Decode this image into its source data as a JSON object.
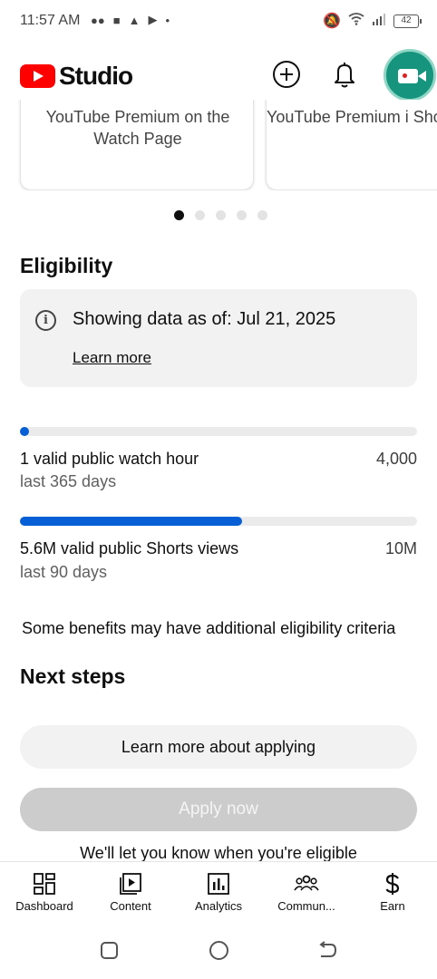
{
  "status_bar": {
    "time": "11:57 AM",
    "battery": "42"
  },
  "header": {
    "brand": "Studio",
    "icons": [
      "youtube-play-logo",
      "create-plus-icon",
      "notifications-bell-icon",
      "go-live-camera-icon"
    ]
  },
  "promo_cards": [
    {
      "text": "YouTube Premium on the Watch Page"
    },
    {
      "text": "YouTube Premium i Shorts Feed"
    }
  ],
  "carousel": {
    "total_dots": 5,
    "active_index": 0
  },
  "eligibility": {
    "title": "Eligibility",
    "info_text": "Showing data as of: Jul 21, 2025",
    "learn_more": "Learn more",
    "metrics": [
      {
        "label": "1 valid public watch hour",
        "period": "last 365 days",
        "goal": "4,000",
        "progress": 0.00025
      },
      {
        "label": "5.6M valid public Shorts views",
        "period": "last 90 days",
        "goal": "10M",
        "progress": 0.56
      }
    ],
    "note": "Some benefits may have additional eligibility criteria"
  },
  "next_steps": {
    "title": "Next steps",
    "learn_button": "Learn more about applying",
    "apply_button": "Apply now",
    "eligible_note": "We'll let you know when you're eligible"
  },
  "bottom_nav": [
    {
      "label": "Dashboard",
      "icon": "dashboard-icon"
    },
    {
      "label": "Content",
      "icon": "content-icon"
    },
    {
      "label": "Analytics",
      "icon": "analytics-icon"
    },
    {
      "label": "Commun...",
      "icon": "community-icon"
    },
    {
      "label": "Earn",
      "icon": "earn-dollar-icon"
    }
  ],
  "colors": {
    "accent_blue": "#065fd4",
    "brand_red": "#ff0000",
    "fab_green": "#17947d"
  }
}
